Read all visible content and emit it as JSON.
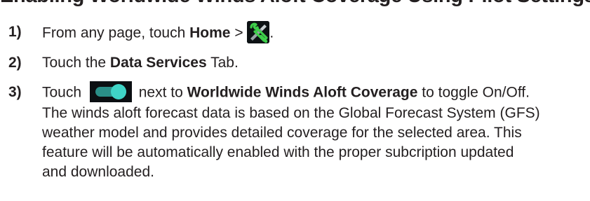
{
  "section_title": "Enabling Worldwide Winds Aloft Coverage Using Pilot Settings",
  "steps": [
    {
      "number": "1)",
      "text_before": "From any page, touch ",
      "bold": "Home",
      "text_after": " > ",
      "end": ".",
      "icon": "tools-settings-icon"
    },
    {
      "number": "2)",
      "text_before": "Touch the ",
      "bold": "Data Services",
      "text_after": " Tab."
    },
    {
      "number": "3)",
      "text_before": "Touch ",
      "icon": "toggle-switch-icon",
      "text_mid": " next to ",
      "bold": "Worldwide Winds Aloft Coverage",
      "text_after": " to toggle On/Off.",
      "lines": [
        "The winds aloft forecast data is based on the Global Forecast System (GFS)",
        "weather model and provides detailed coverage for the selected area. This",
        "feature will be automatically enabled with the proper subcription updated",
        "and downloaded."
      ]
    }
  ],
  "colors": {
    "text": "#231f20",
    "icon_green": "#3ecf4a",
    "toggle_teal": "#3fd4c6"
  }
}
